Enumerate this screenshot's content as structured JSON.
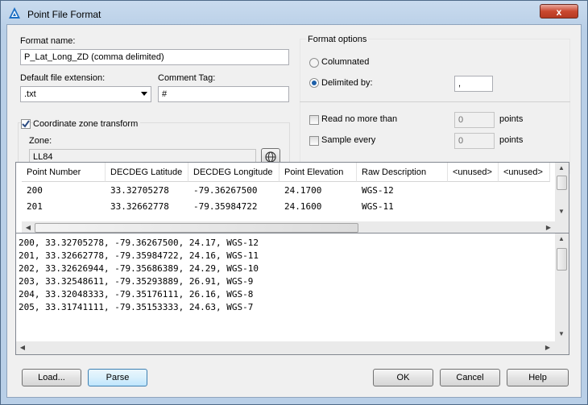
{
  "window": {
    "title": "Point File Format",
    "close": "x"
  },
  "format_name": {
    "label": "Format name:",
    "value": "P_Lat_Long_ZD (comma delimited)"
  },
  "extension": {
    "label": "Default file extension:",
    "value": ".txt"
  },
  "comment_tag": {
    "label": "Comment Tag:",
    "value": "#"
  },
  "zone_transform": {
    "label": "Coordinate zone transform",
    "checked": true,
    "zone_label": "Zone:",
    "zone_value": "LL84"
  },
  "format_options": {
    "title": "Format options",
    "columnated": "Columnated",
    "delimited": "Delimited by:",
    "delimiter": ",",
    "read_no_more": "Read no more than",
    "read_value": "0",
    "sample_every": "Sample every",
    "sample_value": "0",
    "points": "points"
  },
  "grid": {
    "columns": [
      "Point Number",
      "DECDEG Latitude",
      "DECDEG Longitude",
      "Point Elevation",
      "Raw Description",
      "<unused>",
      "<unused>"
    ],
    "rows": [
      [
        "200",
        "33.32705278",
        "-79.36267500",
        "24.1700",
        "WGS-12"
      ],
      [
        "201",
        "33.32662778",
        "-79.35984722",
        "24.1600",
        "WGS-11"
      ]
    ]
  },
  "preview_lines": [
    "200, 33.32705278, -79.36267500, 24.17, WGS-12",
    "201, 33.32662778, -79.35984722, 24.16, WGS-11",
    "202, 33.32626944, -79.35686389, 24.29, WGS-10",
    "203, 33.32548611, -79.35293889, 26.91, WGS-9",
    "204, 33.32048333, -79.35176111, 26.16, WGS-8",
    "205, 33.31741111, -79.35153333, 24.63, WGS-7"
  ],
  "buttons": {
    "load": "Load...",
    "parse": "Parse",
    "ok": "OK",
    "cancel": "Cancel",
    "help": "Help"
  }
}
